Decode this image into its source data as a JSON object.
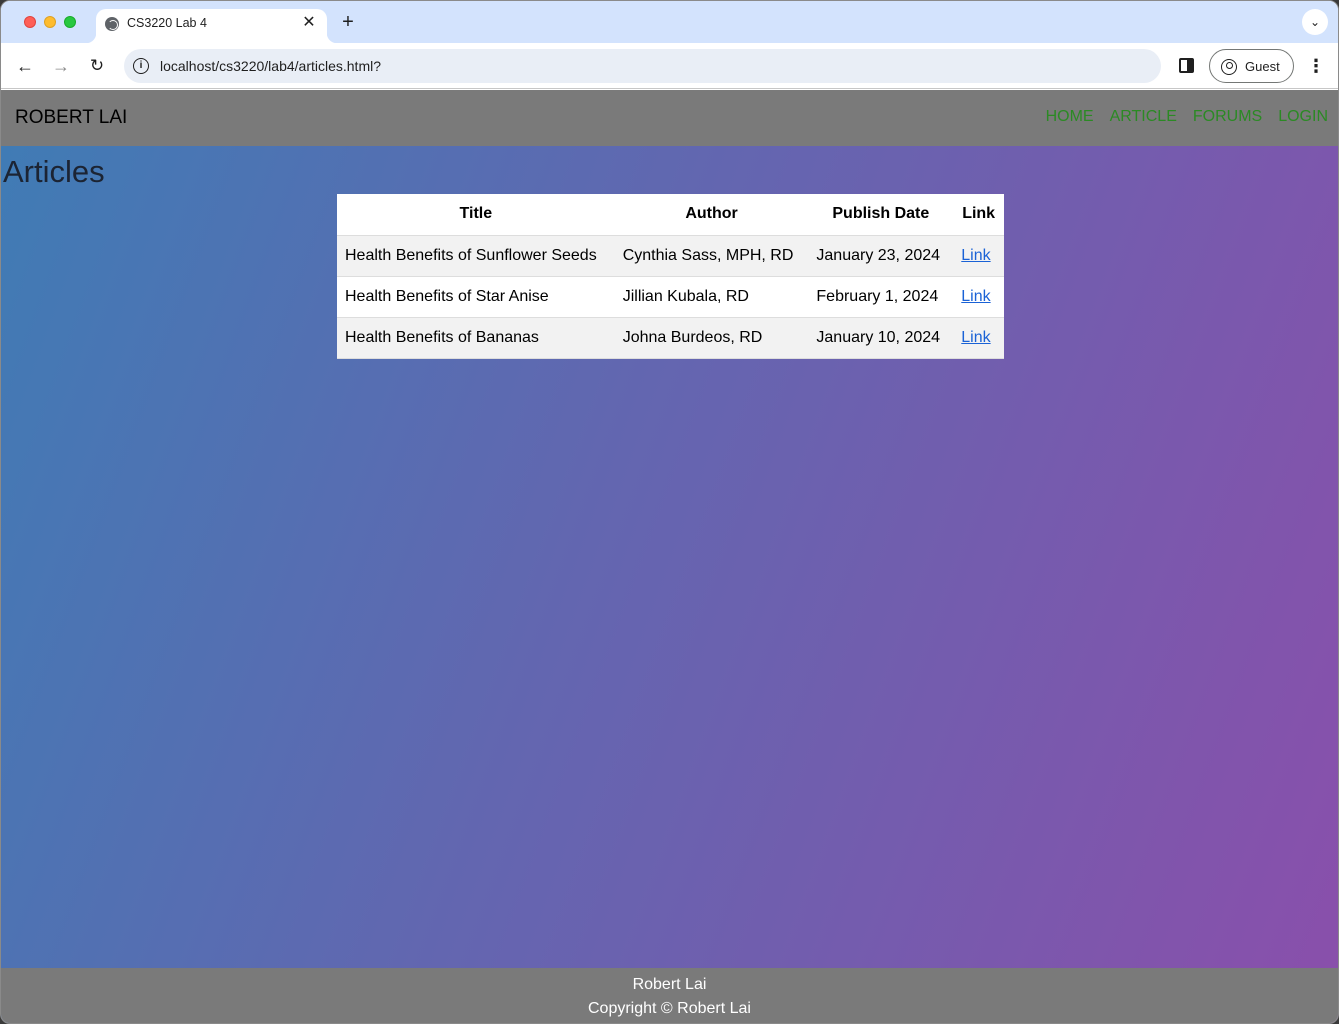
{
  "browser": {
    "tab_title": "CS3220 Lab 4",
    "tab_close": "✕",
    "new_tab": "+",
    "tab_search": "⌄",
    "url": "localhost/cs3220/lab4/articles.html?",
    "profile_label": "Guest",
    "back": "←",
    "forward": "→",
    "reload": "↻",
    "menu": "⋮",
    "info": "i"
  },
  "header": {
    "brand": "ROBERT LAI",
    "nav": [
      "HOME",
      "ARTICLE",
      "FORUMS",
      "LOGIN"
    ]
  },
  "main": {
    "title": "Articles",
    "columns": [
      "Title",
      "Author",
      "Publish Date",
      "Link"
    ],
    "rows": [
      [
        "Health Benefits of Sunflower Seeds",
        "Cynthia Sass, MPH, RD",
        "January 23, 2024",
        "Link"
      ],
      [
        "Health Benefits of Star Anise",
        "Jillian Kubala, RD",
        "February 1, 2024",
        "Link"
      ],
      [
        "Health Benefits of Bananas",
        "Johna Burdeos, RD",
        "January 10, 2024",
        "Link"
      ]
    ]
  },
  "footer": {
    "name": "Robert Lai",
    "copyright": "Copyright © Robert Lai"
  },
  "colors": {
    "header_bg": "#7a7a7a",
    "nav_link": "#2b8a24",
    "table_link": "#1a62d6",
    "gradient_start": "#3f7cb5",
    "gradient_end": "#8a4fab"
  }
}
